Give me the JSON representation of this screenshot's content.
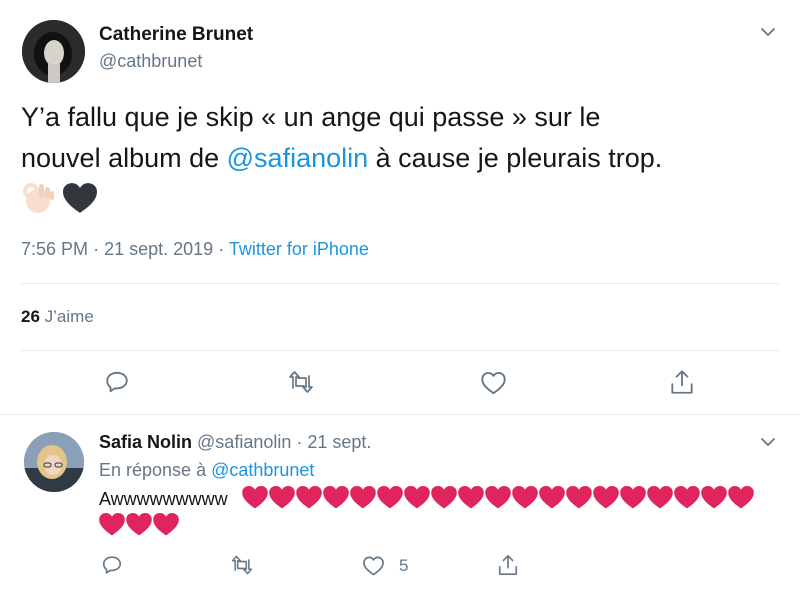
{
  "colors": {
    "text": "#14171a",
    "muted": "#657786",
    "link": "#1b95e0",
    "divider": "#e6ecf0",
    "heart_red": "#e0245e"
  },
  "main_tweet": {
    "author_name": "Catherine Brunet",
    "author_handle": "@cathbrunet",
    "text_part1": "Y’a fallu que je skip « un ange qui passe » sur le",
    "text_part2_prefix": "nouvel album de ",
    "mention": "@safianolin",
    "text_part2_suffix": " à cause je pleurais trop.",
    "emojis": [
      "ok-hand-emoji",
      "black-heart-emoji"
    ],
    "time": "7:56 PM",
    "dot": "·",
    "date": "21 sept. 2019",
    "source": "Twitter for iPhone",
    "likes_count": "26",
    "likes_label": "J’aime",
    "actions": [
      "reply-icon",
      "retweet-icon",
      "like-icon",
      "share-icon"
    ]
  },
  "reply": {
    "author_name": "Safia Nolin",
    "author_handle": "@safianolin",
    "dot": "·",
    "date": "21 sept.",
    "in_reply_to_label": "En réponse à",
    "in_reply_to_handle": "@cathbrunet",
    "text": "Awwwwwwwww",
    "hearts_line1": 19,
    "hearts_line2": 3,
    "like_count": "5",
    "actions": [
      "reply-icon",
      "retweet-icon",
      "like-icon",
      "share-icon"
    ]
  }
}
